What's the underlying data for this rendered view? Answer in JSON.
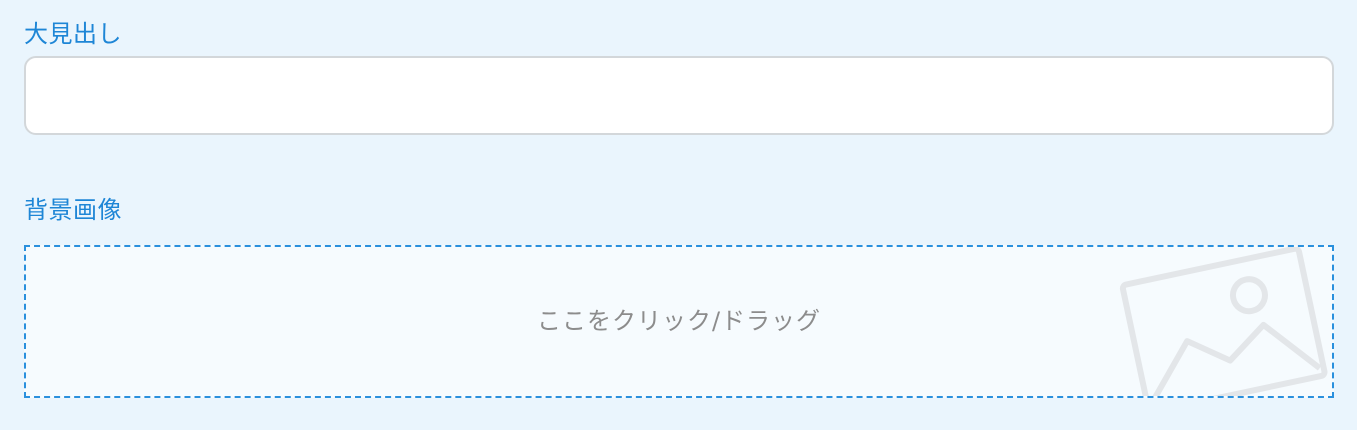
{
  "form": {
    "heading": {
      "label": "大見出し",
      "value": "",
      "placeholder": ""
    },
    "background_image": {
      "label": "背景画像",
      "dropzone_text": "ここをクリック/ドラッグ",
      "icon": "image-icon"
    }
  },
  "colors": {
    "page_background": "#eaf5fd",
    "label_text": "#1e86d6",
    "dropzone_border": "#2a90dd",
    "dropzone_text": "#8c8c8c",
    "input_border": "#d3d7da"
  }
}
